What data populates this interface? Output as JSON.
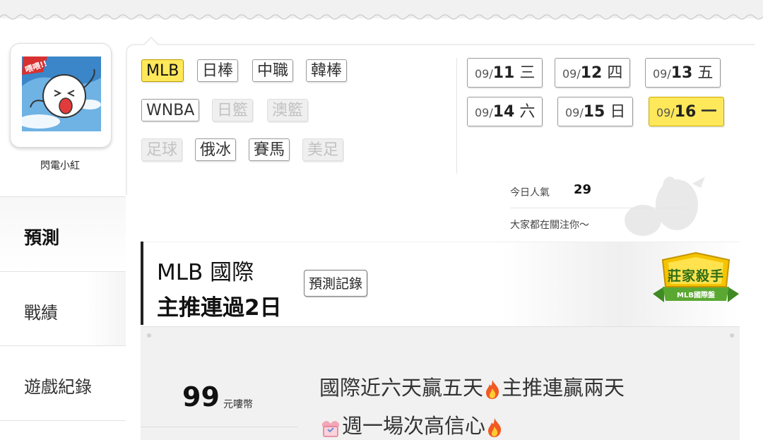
{
  "user": {
    "name": "閃電小紅",
    "avatar_text": "喂喂!!"
  },
  "menu": {
    "items": [
      {
        "label": "預測"
      },
      {
        "label": "戰績"
      },
      {
        "label": "遊戲紀錄"
      }
    ]
  },
  "leagues": {
    "row1": [
      {
        "label": "MLB",
        "state": "active"
      },
      {
        "label": "日棒",
        "state": "normal"
      },
      {
        "label": "中職",
        "state": "normal"
      },
      {
        "label": "韓棒",
        "state": "normal"
      }
    ],
    "row2": [
      {
        "label": "WNBA",
        "state": "normal"
      },
      {
        "label": "日籃",
        "state": "disabled"
      },
      {
        "label": "澳籃",
        "state": "disabled"
      }
    ],
    "row3": [
      {
        "label": "足球",
        "state": "disabled"
      },
      {
        "label": "俄冰",
        "state": "normal"
      },
      {
        "label": "賽馬",
        "state": "normal"
      },
      {
        "label": "美足",
        "state": "disabled"
      }
    ]
  },
  "dates": [
    {
      "md": "09/",
      "day": "11",
      "weekday": "三",
      "active": false
    },
    {
      "md": "09/",
      "day": "12",
      "weekday": "四",
      "active": false
    },
    {
      "md": "09/",
      "day": "13",
      "weekday": "五",
      "active": false
    },
    {
      "md": "09/",
      "day": "14",
      "weekday": "六",
      "active": false
    },
    {
      "md": "09/",
      "day": "15",
      "weekday": "日",
      "active": false
    },
    {
      "md": "09/",
      "day": "16",
      "weekday": "一",
      "active": true
    }
  ],
  "popularity": {
    "label": "今日人氣",
    "value": "29",
    "message": "大家都在關注你～"
  },
  "prediction": {
    "title_line1": "MLB 國際",
    "title_line2": "主推連過2日",
    "record_button": "預測記錄",
    "badge_main": "莊家殺手",
    "badge_sub": "MLB國際盤",
    "price": "99",
    "price_unit": "元嘍幣",
    "desc_line1_a": "國際近六天贏五天",
    "desc_line1_b": "主推連贏兩天",
    "desc_line2": "週一場次高信心"
  },
  "colors": {
    "active_yellow": "#ffe85a",
    "badge_green": "#5aa832",
    "badge_gold": "#f5c400"
  }
}
